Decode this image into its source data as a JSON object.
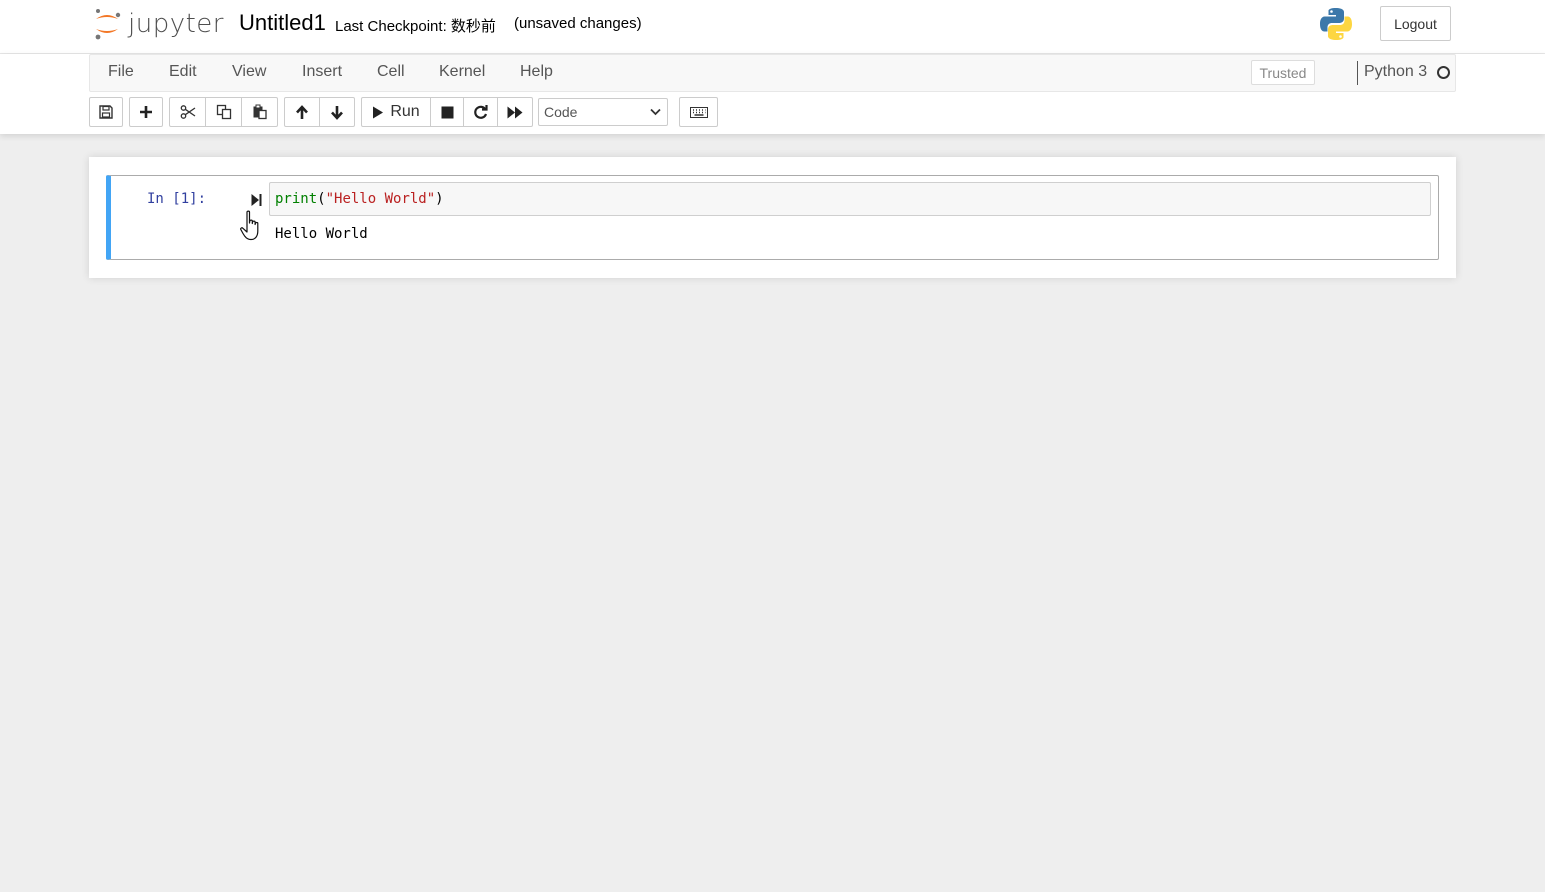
{
  "header": {
    "logo_text": "jupyter",
    "notebook_name": "Untitled1",
    "checkpoint": "Last Checkpoint: 数秒前",
    "autosave_status": "(unsaved changes)",
    "logout_label": "Logout",
    "kernel_logo_icon": "python-logo-icon"
  },
  "menubar": {
    "items": [
      "File",
      "Edit",
      "View",
      "Insert",
      "Cell",
      "Kernel",
      "Help"
    ],
    "trusted_label": "Trusted",
    "kernel_name": "Python 3",
    "kernel_status": "idle"
  },
  "toolbar": {
    "run_label": "Run",
    "cell_type": "Code",
    "icons": [
      "save-icon",
      "plus-icon",
      "scissors-icon",
      "copy-icon",
      "paste-icon",
      "arrow-up-icon",
      "arrow-down-icon",
      "play-icon",
      "stop-icon",
      "refresh-icon",
      "fast-forward-icon",
      "keyboard-icon"
    ]
  },
  "cell": {
    "prompt": "In [1]:",
    "code_builtin": "print",
    "code_open": "(",
    "code_string": "\"Hello World\"",
    "code_close": ")",
    "output": "Hello World"
  },
  "colors": {
    "selected_cell_border": "#42a5f5",
    "prompt": "#303f9f",
    "builtin": "#008000",
    "string": "#ba2121",
    "jupyter_orange": "#f37726"
  }
}
